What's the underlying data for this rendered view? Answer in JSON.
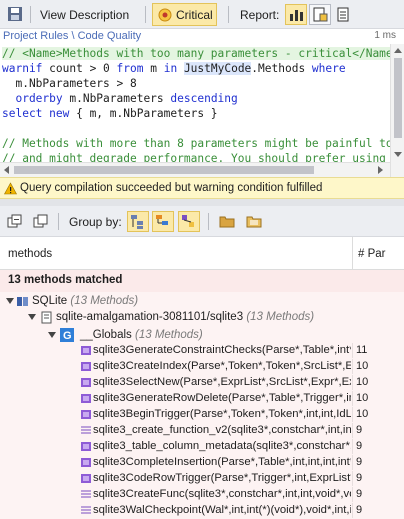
{
  "toolbar": {
    "view_description": "View Description",
    "critical": "Critical",
    "report": "Report:"
  },
  "breadcrumb": {
    "label": "Project Rules \\ Code Quality",
    "time": "1 ms"
  },
  "code": {
    "line1": "// <Name>Methods with too many parameters - critical</Name>",
    "line2_kw1": "warnif",
    "line2_a": " count > ",
    "line2_num": "0",
    "line2_kw2": " from",
    "line2_b": " m ",
    "line2_kw3": "in",
    "line2_c": " ",
    "line2_id": "JustMyCode",
    "line2_d": ".Methods ",
    "line2_kw4": "where",
    "line3": "  m.NbParameters > 8",
    "line4_kw": "  orderby",
    "line4_rest": " m.NbParameters ",
    "line4_kw2": "descending",
    "line5_kw": "select new",
    "line5_rest": " { m, m.NbParameters }",
    "line7": "// Methods with more than 8 parameters might be painful to call",
    "line8": "// and might degrade performance. You should prefer using"
  },
  "status": {
    "text": "Query compilation succeeded but warning condition fulfilled"
  },
  "toolbar2": {
    "group_by": "Group by:"
  },
  "table": {
    "col_methods": "methods",
    "col_params": "# Par",
    "matched": "13 methods matched"
  },
  "tree": {
    "assembly": "SQLite",
    "assembly_count": "(13 Methods)",
    "namespace": "sqlite-amalgamation-3081101/sqlite3",
    "namespace_count": "(13 Methods)",
    "type": "__Globals",
    "type_count": "(13 Methods)",
    "methods": [
      {
        "name": "sqlite3GenerateConstraintChecks(Parse*,Table*,int*,int",
        "params": "11"
      },
      {
        "name": "sqlite3CreateIndex(Parse*,Token*,Token*,SrcList*,Expr",
        "params": "10"
      },
      {
        "name": "sqlite3SelectNew(Parse*,ExprList*,SrcList*,Expr*,ExprL",
        "params": "10"
      },
      {
        "name": "sqlite3GenerateRowDelete(Parse*,Table*,Trigger*,int,i",
        "params": "10"
      },
      {
        "name": "sqlite3BeginTrigger(Parse*,Token*,Token*,int,int,IdList",
        "params": "10"
      },
      {
        "name": "sqlite3_create_function_v2(sqlite3*,constchar*,int,int,v",
        "params": "9"
      },
      {
        "name": "sqlite3_table_column_metadata(sqlite3*,constchar*,cons",
        "params": "9"
      },
      {
        "name": "sqlite3CompleteInsertion(Parse*,Table*,int,int,int,int*,i",
        "params": "9"
      },
      {
        "name": "sqlite3CodeRowTrigger(Parse*,Trigger*,int,ExprList*,int",
        "params": "9"
      },
      {
        "name": "sqlite3CreateFunc(sqlite3*,constchar*,int,int,void*,void",
        "params": "9"
      },
      {
        "name": "sqlite3WalCheckpoint(Wal*,int,int(*)(void*),void*,int,int",
        "params": "9"
      }
    ]
  },
  "colors": {
    "accent": "#fbe9a8",
    "status_bg": "#fef7c9",
    "matched_bg": "#fbeaea",
    "link": "#4b6cb7"
  }
}
